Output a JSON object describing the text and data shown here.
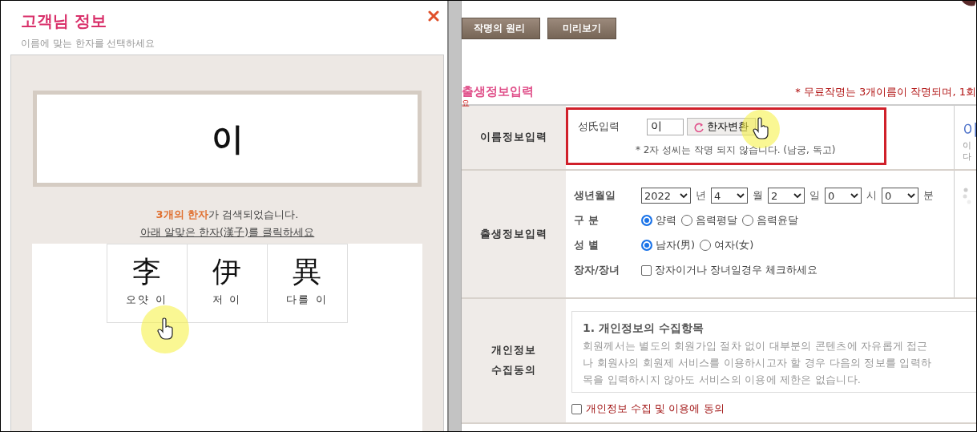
{
  "popup": {
    "title": "고객님 정보",
    "subtitle": "이름에 맞는 한자를 선택하세요",
    "name_display": "이",
    "result_text": "**3개의 한자**가 검색되었습니다.",
    "instruction": "아래 알맞은 한자(漢子)를 클릭하세요",
    "hanja": [
      {
        "char": "李",
        "meaning": "오얏 이"
      },
      {
        "char": "伊",
        "meaning": "저 이"
      },
      {
        "char": "異",
        "meaning": "다를 이"
      }
    ]
  },
  "page": {
    "buttons": [
      "작명의 원리",
      "미리보기"
    ],
    "section_title": "출생정보입력",
    "notice": "* 무료작명는 3개이름이 작명되며, 1회",
    "stray_text": "요",
    "rows": [
      {
        "kind": "name_entry",
        "label": "이름정보입력",
        "highlighted": true,
        "field_label": "성氏입력",
        "value": "이",
        "button": "한자변환",
        "note": "* 2자 성씨는 작명 되지 않습니다. (남궁, 독고)"
      },
      {
        "kind": "birth",
        "label": "출생정보입력",
        "fields": [
          {
            "kind": "date",
            "label": "생년월일",
            "selects": [
              {
                "value": "2022",
                "unit": "년"
              },
              {
                "value": "4",
                "unit": "월"
              },
              {
                "value": "2",
                "unit": "일"
              },
              {
                "value": "0",
                "unit": "시"
              },
              {
                "value": "0",
                "unit": "분"
              }
            ]
          },
          {
            "kind": "radio",
            "label": "구 분",
            "options": [
              {
                "text": "양력",
                "selected": true
              },
              {
                "text": "음력평달",
                "selected": false
              },
              {
                "text": "음력윤달",
                "selected": false
              }
            ]
          },
          {
            "kind": "radio",
            "label": "성 별",
            "options": [
              {
                "text": "남자(男)",
                "selected": true
              },
              {
                "text": "여자(女)",
                "selected": false
              }
            ]
          },
          {
            "kind": "checkbox",
            "label": "장자/장녀",
            "text": "장자이거나 장녀일경우 체크하세요",
            "checked": false
          }
        ]
      },
      {
        "kind": "privacy",
        "label": "개인정보 수집동의",
        "title": "1. 개인정보의 수집항목",
        "lines": [
          "회원께서는 별도의 회원가입 절차 없이 대부분의 콘텐츠에 자유롭게 접근",
          "나 회원사의 회원제 서비스를 이용하시고자 할 경우 다음의 정보를 입력하",
          "목을 입력하시지 않아도 서비스의 이용에 제한은 없습니다."
        ],
        "consent": "개인정보 수집 및 이용에 동의",
        "checked": false
      }
    ],
    "side": {
      "heading": "이",
      "lines": [
        "이",
        "다"
      ]
    }
  }
}
